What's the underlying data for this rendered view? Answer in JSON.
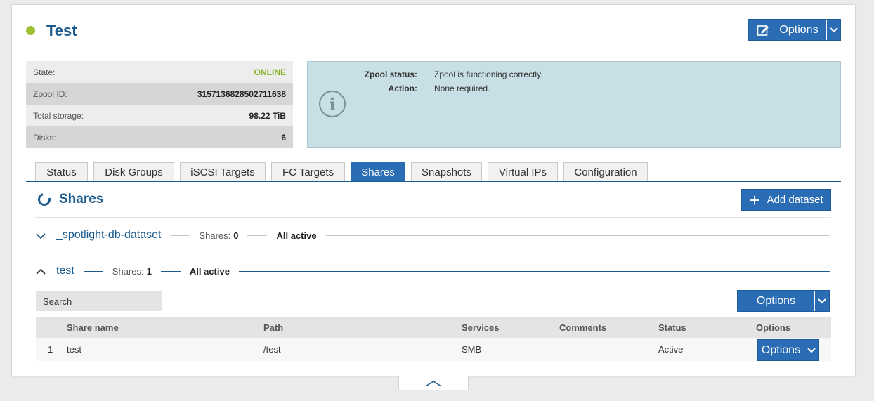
{
  "pool": {
    "name": "Test",
    "status_color": "#9fc131",
    "options_label": "Options"
  },
  "info": [
    {
      "label": "State:",
      "value": "ONLINE"
    },
    {
      "label": "Zpool ID:",
      "value": "3157136828502711638"
    },
    {
      "label": "Total storage:",
      "value": "98.22 TiB"
    },
    {
      "label": "Disks:",
      "value": "6"
    }
  ],
  "status_box": {
    "icon": "info-circle-icon",
    "status_label": "Zpool status:",
    "status_value": "Zpool is functioning correctly.",
    "action_label": "Action:",
    "action_value": "None required."
  },
  "tabs": [
    {
      "label": "Status"
    },
    {
      "label": "Disk Groups"
    },
    {
      "label": "iSCSI Targets"
    },
    {
      "label": "FC Targets"
    },
    {
      "label": "Shares",
      "active": true
    },
    {
      "label": "Snapshots"
    },
    {
      "label": "Virtual IPs"
    },
    {
      "label": "Configuration"
    }
  ],
  "shares": {
    "title": "Shares",
    "add_label": "Add dataset",
    "datasets": [
      {
        "name": "_spotlight-db-dataset",
        "shares_label": "Shares:",
        "shares_count": "0",
        "state": "All active",
        "expanded": false
      },
      {
        "name": "test",
        "shares_label": "Shares:",
        "shares_count": "1",
        "state": "All active",
        "expanded": true
      }
    ],
    "search_placeholder": "Search",
    "options_label": "Options",
    "columns": [
      "Share name",
      "Path",
      "Services",
      "Comments",
      "Status",
      "Options"
    ],
    "rows": [
      {
        "index": "1",
        "name": "test",
        "path": "/test",
        "services": "SMB",
        "comments": "",
        "status": "Active",
        "options_label": "Options"
      }
    ]
  },
  "colors": {
    "accent": "#2b6db5",
    "title": "#1c5b8e",
    "online": "#8ab22b",
    "status_box": "#c8dfe6"
  }
}
